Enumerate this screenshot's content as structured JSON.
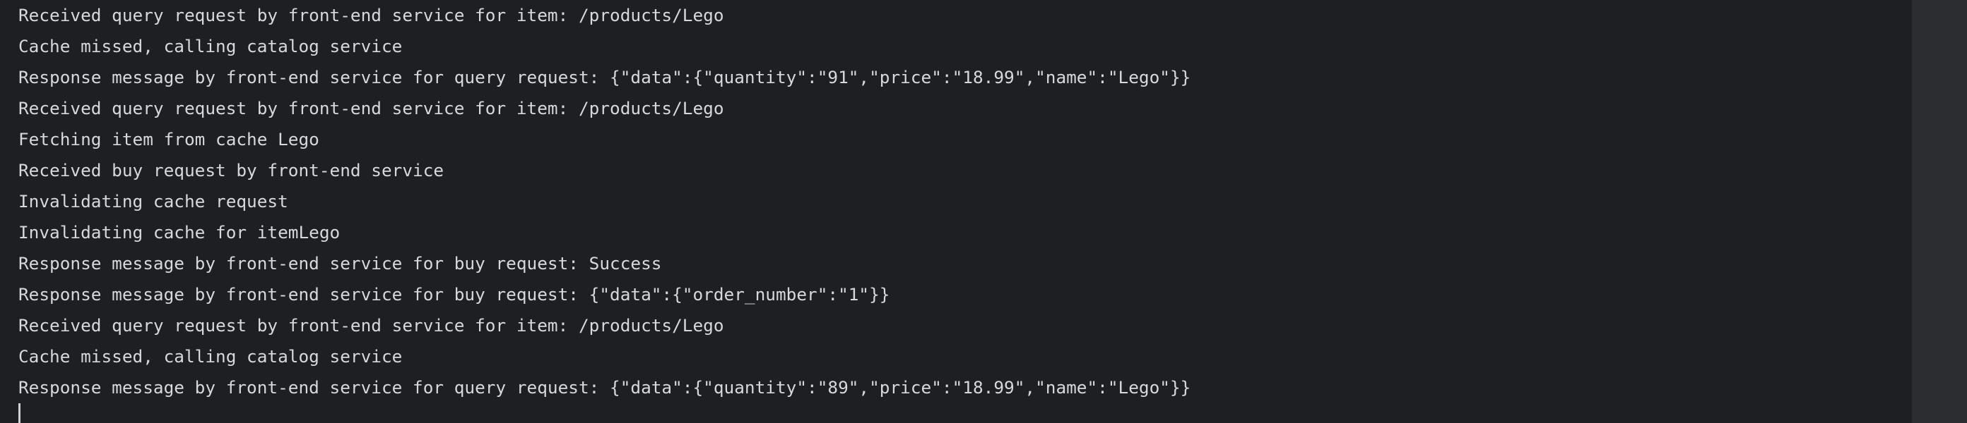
{
  "console": {
    "lines": [
      "Received query request by front-end service for item: /products/Lego",
      "Cache missed, calling catalog service",
      "Response message by front-end service for query request: {\"data\":{\"quantity\":\"91\",\"price\":\"18.99\",\"name\":\"Lego\"}}",
      "Received query request by front-end service for item: /products/Lego",
      "Fetching item from cache Lego",
      "Received buy request by front-end service",
      "Invalidating cache request",
      "Invalidating cache for itemLego",
      "Response message by front-end service for buy request: Success",
      "Response message by front-end service for buy request: {\"data\":{\"order_number\":\"1\"}}",
      "Received query request by front-end service for item: /products/Lego",
      "Cache missed, calling catalog service",
      "Response message by front-end service for query request: {\"data\":{\"quantity\":\"89\",\"price\":\"18.99\",\"name\":\"Lego\"}}"
    ]
  },
  "colors": {
    "background": "#1e1f22",
    "text": "#d6d8dc",
    "gutter": "#2b2d30",
    "caret": "#ced0d6"
  }
}
